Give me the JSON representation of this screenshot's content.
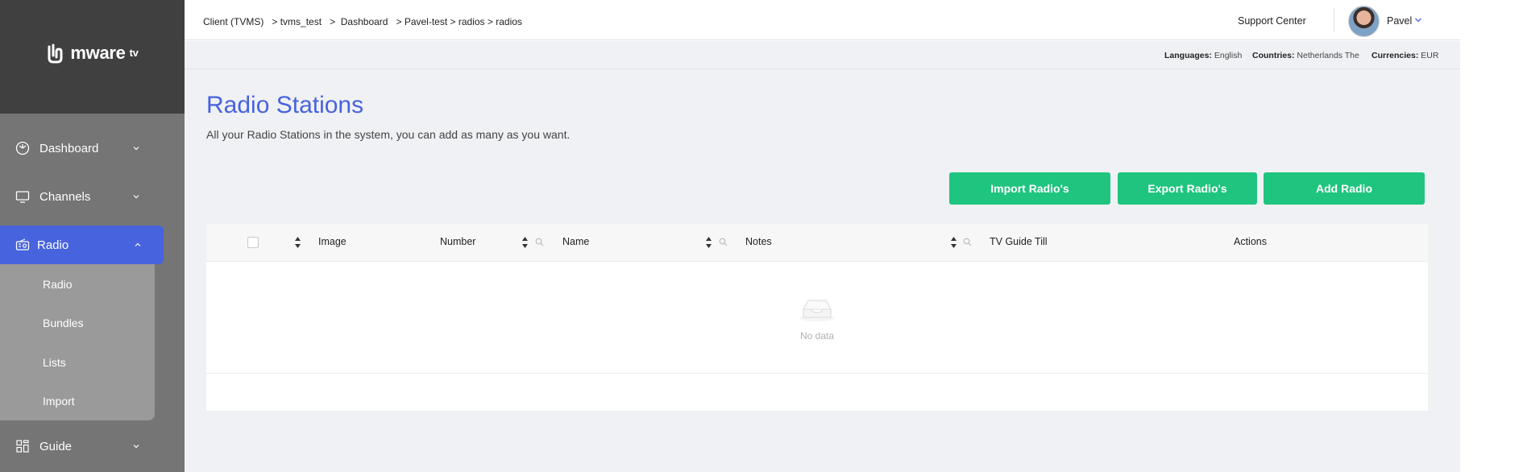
{
  "brand": {
    "name": "mware",
    "suffix": "tv",
    "colors": {
      "accent": "#4763dd",
      "button": "#1fc47f",
      "sidebar": "#757575",
      "sidebar_header": "#404040"
    }
  },
  "sidebar": {
    "items": [
      {
        "label": "Dashboard",
        "icon": "dashboard-icon"
      },
      {
        "label": "Channels",
        "icon": "monitor-icon"
      },
      {
        "label": "Radio",
        "icon": "radio-icon",
        "active": true
      },
      {
        "label": "Guide",
        "icon": "grid-icon"
      }
    ],
    "submenu": [
      "Radio",
      "Bundles",
      "Lists",
      "Import"
    ]
  },
  "header": {
    "breadcrumb": [
      "Client (TVMS)",
      "tvms_test",
      "Dashboard",
      "Pavel-test",
      "radios",
      "radios"
    ],
    "support": "Support Center",
    "user": "Pavel"
  },
  "subbar": {
    "languages_label": "Languages:",
    "languages_value": "English",
    "countries_label": "Countries:",
    "countries_value": "Netherlands The",
    "currencies_label": "Currencies:",
    "currencies_value": "EUR"
  },
  "main": {
    "title": "Radio Stations",
    "subtitle": "All your Radio Stations in the system, you can add as many as you want.",
    "buttons": {
      "import": "Import Radio's",
      "export": "Export Radio's",
      "add": "Add Radio"
    }
  },
  "table": {
    "columns": [
      "Image",
      "Number",
      "Name",
      "Notes",
      "TV Guide Till",
      "Actions"
    ],
    "empty_text": "No data"
  }
}
